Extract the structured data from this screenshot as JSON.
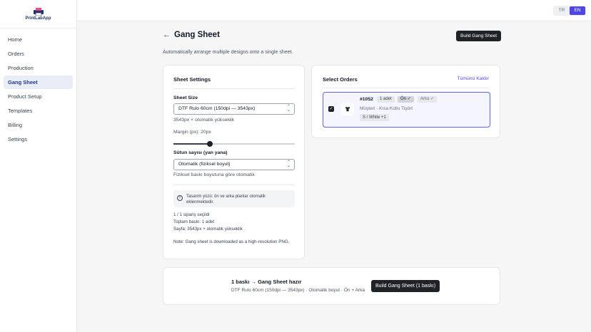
{
  "app": {
    "logo_text": "PrintLabApp"
  },
  "sidebar": {
    "items": [
      {
        "label": "Home"
      },
      {
        "label": "Orders"
      },
      {
        "label": "Production"
      },
      {
        "label": "Gang Sheet"
      },
      {
        "label": "Product Setup"
      },
      {
        "label": "Templates"
      },
      {
        "label": "Billing"
      },
      {
        "label": "Settings"
      }
    ],
    "active": "Gang Sheet"
  },
  "topbar": {
    "lang_tr": "TR",
    "lang_en": "EN",
    "active_lang": "EN"
  },
  "header": {
    "back_glyph": "←",
    "title": "Gang Sheet",
    "build_button": "Build Gang Sheet",
    "subtitle": "Automatically arrange multiple designs onto a single sheet."
  },
  "settings": {
    "title": "Sheet Settings",
    "sheet_size_label": "Sheet Size",
    "sheet_size_value": "DTF Rulo 60cm (150dpi — 3543px)",
    "sheet_size_hint": "3543px × otomatik yükseklik",
    "margin_label": "Margin (px): 20px",
    "margin_value": 0.3,
    "columns_label": "Sütun sayısı (yan yana)",
    "columns_value": "Otomatik (fiziksel boyut)",
    "columns_hint": "Fiziksel baskı boyutuna göre otomatik",
    "info_icon": "!",
    "info_text": "Tasarım yüzü: ön ve arka planlar otomatik eklenmektedir.",
    "stat_selected": "1 / 1 sipariş seçildi",
    "stat_total": "Toplam baskı: 1 adet",
    "stat_page": "Sayfa: 3543px × otomatik yükseklik",
    "note": "Note: Gang sheet is downloaded as a high-resolution PNG."
  },
  "orders": {
    "title": "Select Orders",
    "clear_all": "Tümünü Kaldır",
    "items": [
      {
        "checked": true,
        "check_glyph": "✓",
        "id": "#1052",
        "qty": "1 adet",
        "front": "Ön ✓",
        "back": "Arka ✓",
        "subtitle": "Müşteri · Kısa Kollu Tişört",
        "variant": "S / White +1"
      }
    ]
  },
  "summary": {
    "title": "1 baskı → Gang Sheet hazır",
    "subtitle": "DTF Rulo 60cm (150dpi — 3543px) · Otomatik boyut · Ön + Arka",
    "button": "Build Gang Sheet (1 baskı)"
  },
  "colors": {
    "accent": "#4f46e5",
    "dark_button": "#1f2328",
    "active_nav_bg": "#e8edf8"
  }
}
